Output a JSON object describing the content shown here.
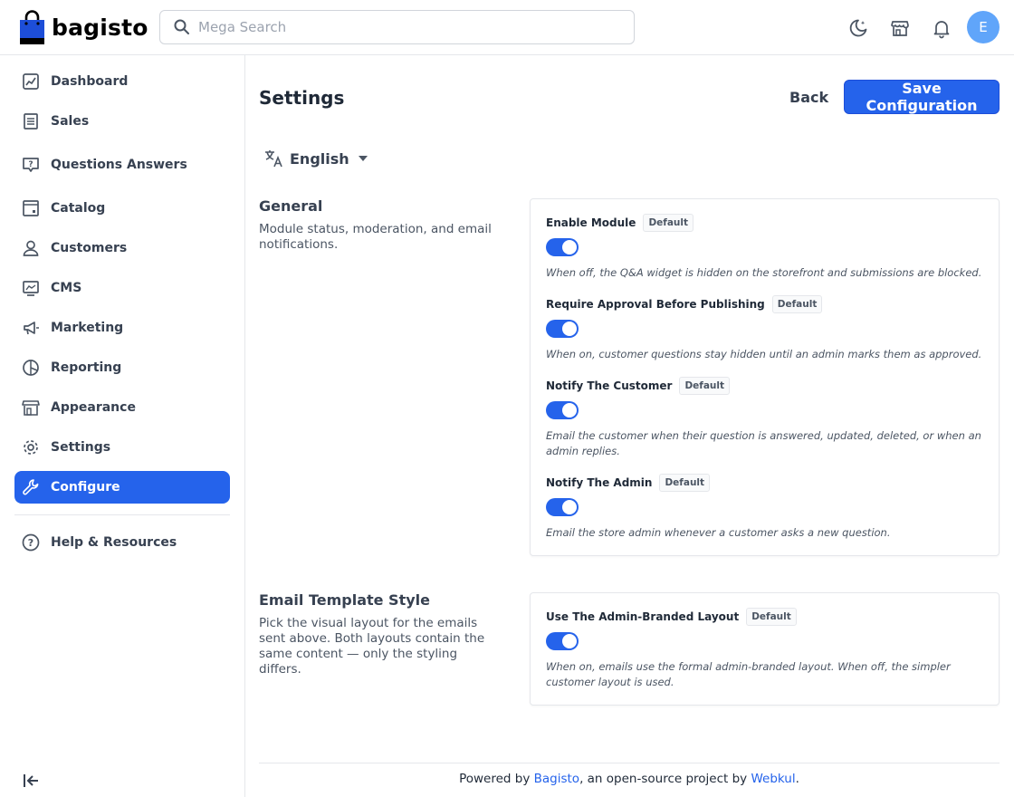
{
  "brand": {
    "name": "bagisto",
    "color": "#1d4ed8"
  },
  "search": {
    "placeholder": "Mega Search"
  },
  "header": {
    "icons": [
      "dark-mode-icon",
      "storefront-icon",
      "notifications-bell-icon"
    ],
    "avatar_initial": "E",
    "avatar_color": "#60a5fa"
  },
  "sidebar": {
    "items": [
      {
        "label": "Dashboard",
        "icon": "dashboard-icon"
      },
      {
        "label": "Sales",
        "icon": "sales-icon"
      },
      {
        "label": "Questions Answers",
        "icon": "questions-icon"
      },
      {
        "label": "Catalog",
        "icon": "catalog-icon"
      },
      {
        "label": "Customers",
        "icon": "customers-icon"
      },
      {
        "label": "CMS",
        "icon": "cms-icon"
      },
      {
        "label": "Marketing",
        "icon": "marketing-icon"
      },
      {
        "label": "Reporting",
        "icon": "reporting-icon"
      },
      {
        "label": "Appearance",
        "icon": "appearance-icon"
      },
      {
        "label": "Settings",
        "icon": "settings-gear-icon"
      },
      {
        "label": "Configure",
        "icon": "configure-wrench-icon",
        "active": true
      },
      {
        "label": "Help & Resources",
        "icon": "help-icon"
      }
    ],
    "active_color": "#2563eb"
  },
  "main": {
    "title": "Settings",
    "back_label": "Back",
    "save_label": "Save Configuration",
    "locale": "English",
    "sections": [
      {
        "title": "General",
        "description": "Module status, moderation, and email notifications.",
        "fields": [
          {
            "label": "Enable Module",
            "badge": "Default",
            "enabled": true,
            "help": "When off, the Q&A widget is hidden on the storefront and submissions are blocked."
          },
          {
            "label": "Require Approval Before Publishing",
            "badge": "Default",
            "enabled": true,
            "help": "When on, customer questions stay hidden until an admin marks them as approved."
          },
          {
            "label": "Notify The Customer",
            "badge": "Default",
            "enabled": true,
            "help": "Email the customer when their question is answered, updated, deleted, or when an admin replies."
          },
          {
            "label": "Notify The Admin",
            "badge": "Default",
            "enabled": true,
            "help": "Email the store admin whenever a customer asks a new question."
          }
        ]
      },
      {
        "title": "Email Template Style",
        "description": "Pick the visual layout for the emails sent above. Both layouts contain the same content — only the styling differs.",
        "fields": [
          {
            "label": "Use The Admin-Branded Layout",
            "badge": "Default",
            "enabled": true,
            "help": "When on, emails use the formal admin-branded layout. When off, the simpler customer layout is used."
          }
        ]
      }
    ]
  },
  "footer": {
    "prefix": "Powered by ",
    "link1": "Bagisto",
    "middle": ", an open-source project by ",
    "link2": "Webkul",
    "suffix": "."
  }
}
